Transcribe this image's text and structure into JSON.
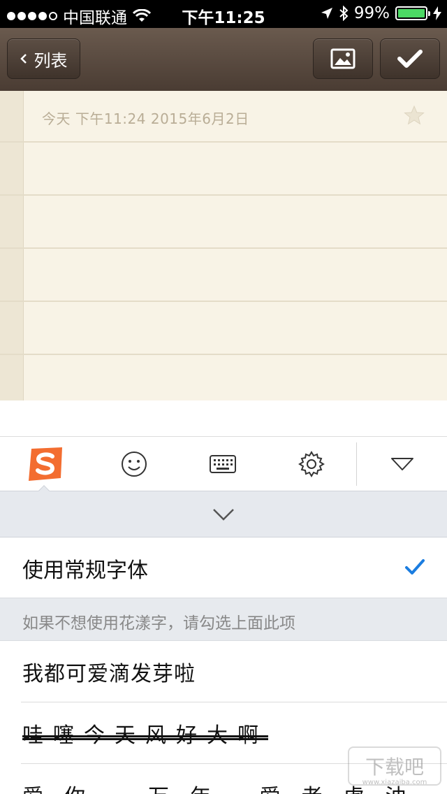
{
  "status_bar": {
    "carrier": "中国联通",
    "time": "下午11:25",
    "battery_percent_label": "99%",
    "battery_level": 0.99
  },
  "nav_bar": {
    "back_label": "列表"
  },
  "note": {
    "date_text": "今天  下午11:24  2015年6月2日"
  },
  "font_panel": {
    "regular_font_label": "使用常规字体",
    "hint_text": "如果不想使用花漾字，请勾选上面此项",
    "fancy_fonts": [
      "我都可爱滴发芽啦",
      "哇噻今天风好大啊",
      "爱你一万年  爱老虎油"
    ]
  },
  "watermark": {
    "text": "下载吧",
    "sub": "www.xiazaiba.com"
  },
  "colors": {
    "nav_bar": "#4a3c33",
    "note_paper": "#f8f3e6",
    "sogou_orange": "#f36d30",
    "check_blue": "#1b7de0",
    "battery_green": "#4cd964"
  }
}
